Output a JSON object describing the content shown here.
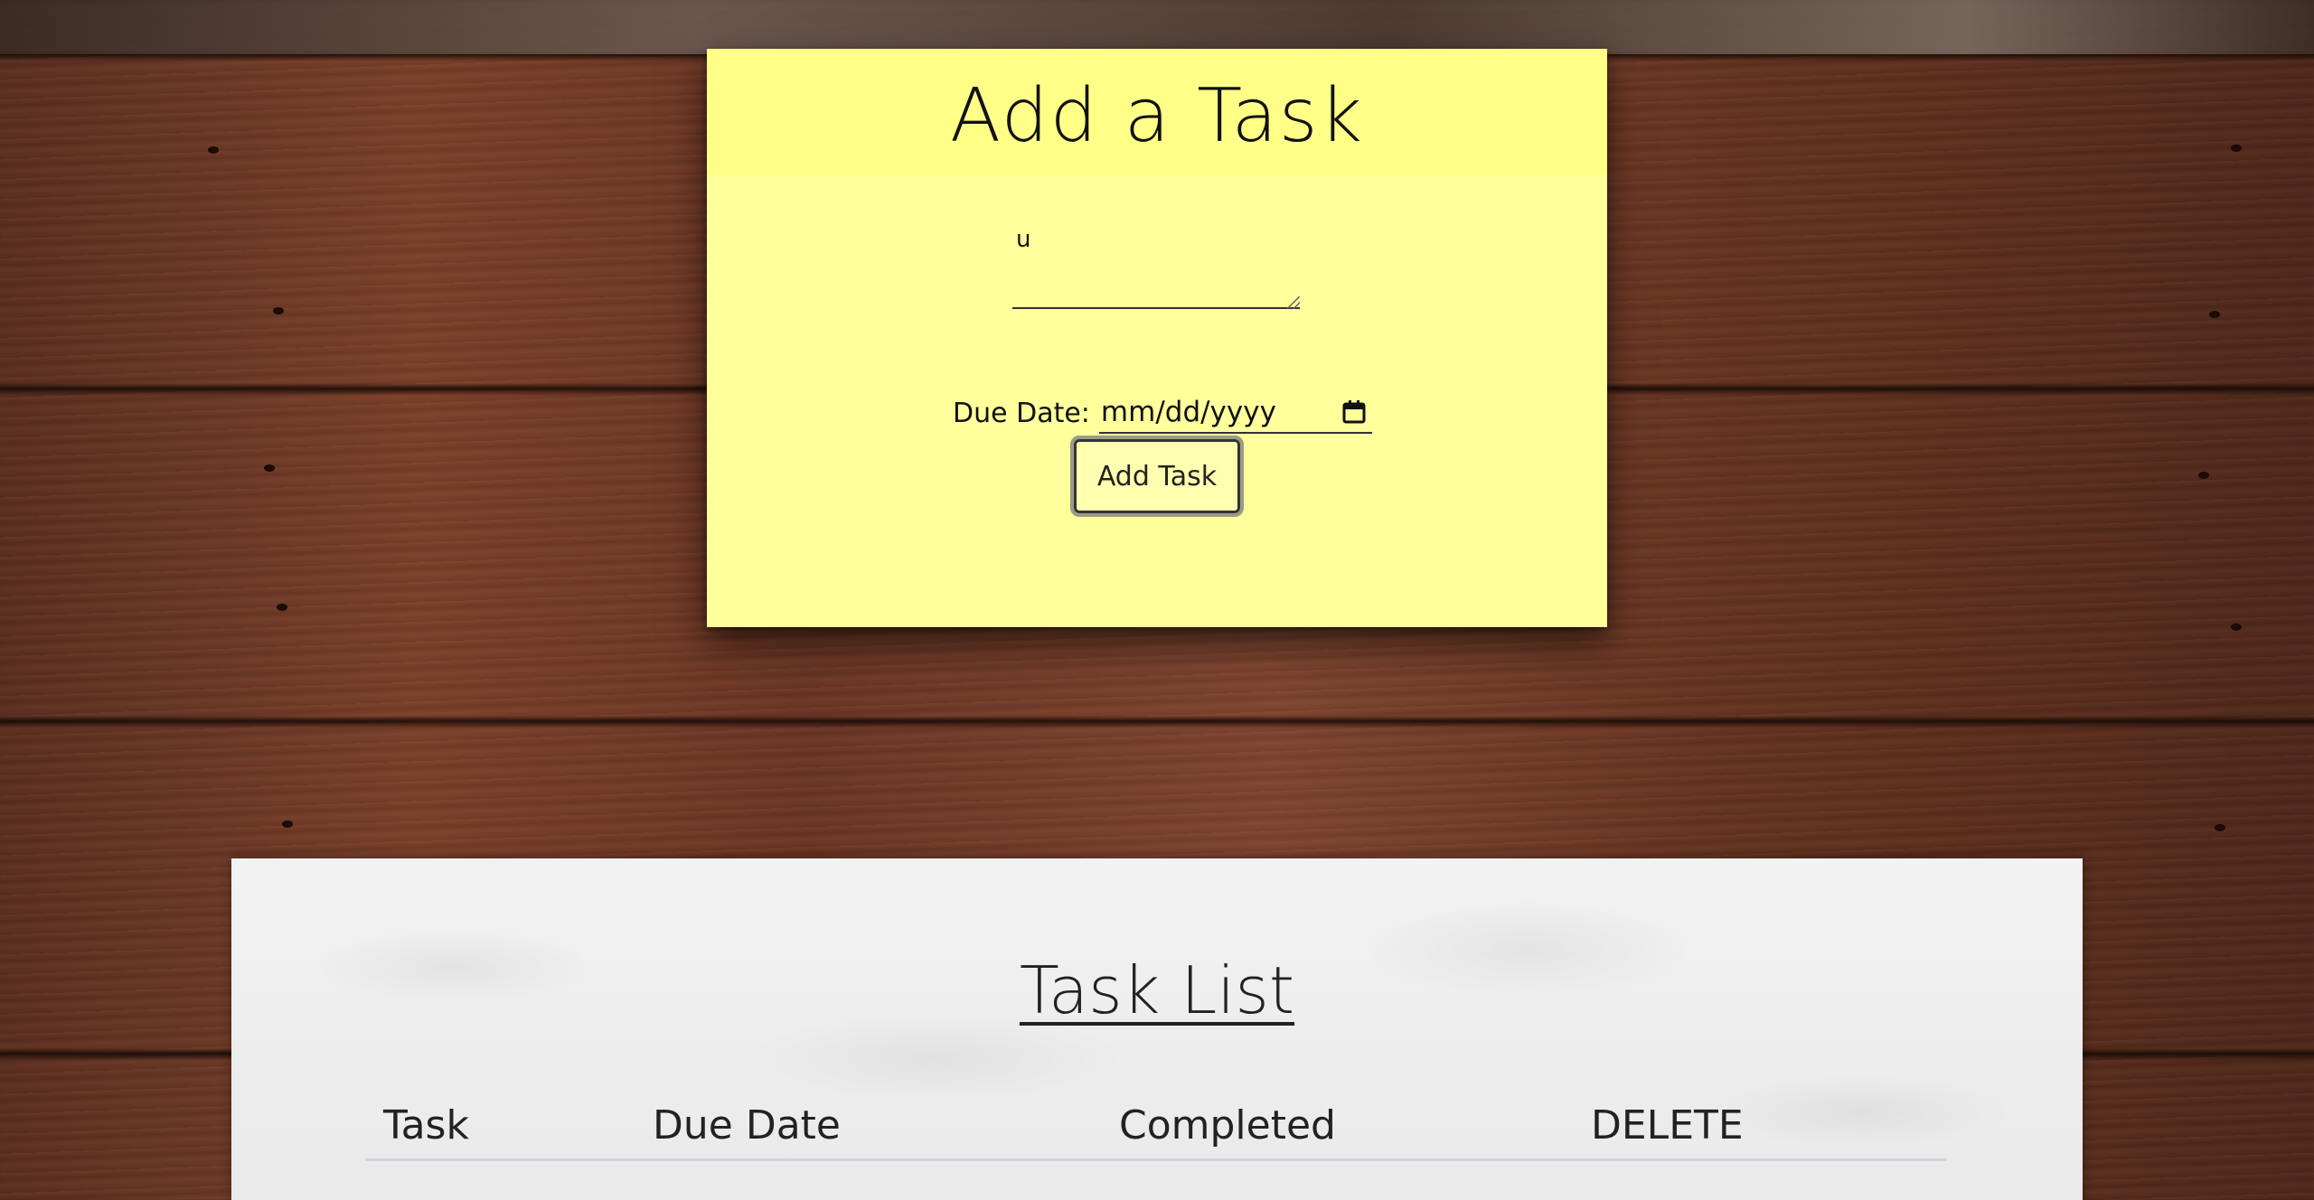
{
  "add_task": {
    "title": "Add a Task",
    "task_input_value": "u",
    "due_date_label": "Due Date:",
    "date_placeholder": "mm/dd/yyyy",
    "add_button_label": "Add Task"
  },
  "task_list": {
    "title": "Task List",
    "columns": [
      "Task",
      "Due Date",
      "Completed",
      "DELETE"
    ]
  },
  "icons": {
    "calendar": "calendar-icon"
  },
  "colors": {
    "sticky_note": "#ffff9c",
    "paper": "#f0f0f0",
    "wood": "#6b3524",
    "text": "#111111"
  }
}
